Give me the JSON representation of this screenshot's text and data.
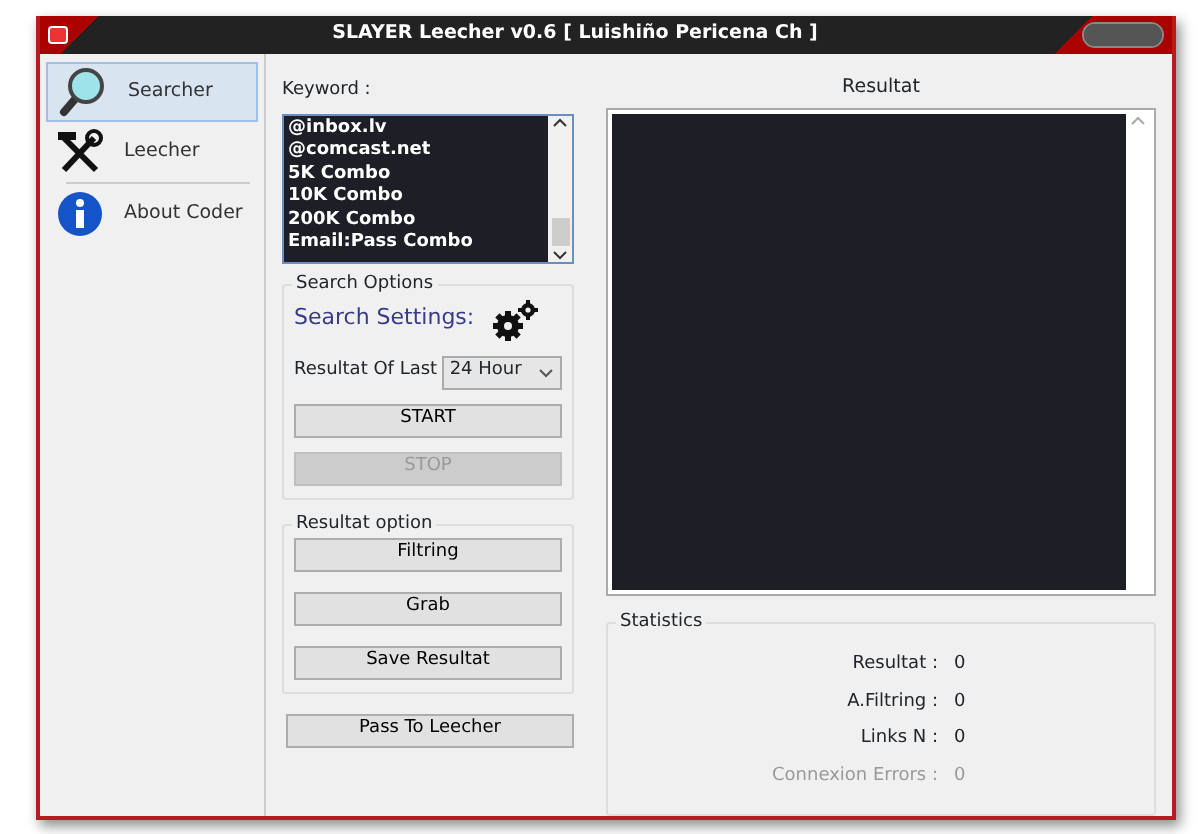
{
  "window": {
    "title": "SLAYER Leecher v0.6 [ Luishiño Pericena Ch ]"
  },
  "sidebar": {
    "items": [
      {
        "label": "Searcher",
        "kind": "search",
        "selected": true
      },
      {
        "label": "Leecher",
        "kind": "tools",
        "selected": false
      },
      {
        "label": "About Coder",
        "kind": "info",
        "selected": false
      }
    ]
  },
  "keyword": {
    "label": "Keyword :",
    "items": [
      "@inbox.lv",
      "@comcast.net",
      "5K Combo",
      "10K Combo",
      "200K Combo",
      "Email:Pass Combo"
    ]
  },
  "search_options": {
    "title": "Search Options",
    "settings_label": "Search Settings:",
    "period_label": "Resultat Of Last",
    "period_value": "24 Hour",
    "buttons": [
      {
        "label": "START",
        "disabled": false
      },
      {
        "label": "STOP",
        "disabled": true
      }
    ]
  },
  "resultat_option": {
    "title": "Resultat option",
    "buttons": [
      "Filtring",
      "Grab",
      "Save Resultat"
    ]
  },
  "pass_button": "Pass To Leecher",
  "resultat": {
    "label": "Resultat"
  },
  "statistics": {
    "title": "Statistics",
    "rows": [
      {
        "label": "Resultat :",
        "value": "0",
        "disabled": false
      },
      {
        "label": "A.Filtring :",
        "value": "0",
        "disabled": false
      },
      {
        "label": "Links N :",
        "value": "0",
        "disabled": false
      },
      {
        "label": "Connexion Errors :",
        "value": "0",
        "disabled": true
      }
    ]
  }
}
